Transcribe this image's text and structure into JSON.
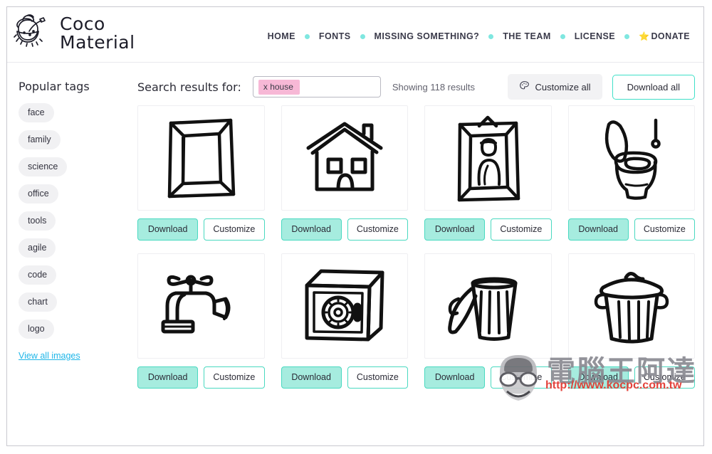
{
  "site": {
    "logo_line1": "Coco",
    "logo_line2": "Material",
    "logo_icon": "coconut-drink-icon"
  },
  "nav": {
    "items": [
      {
        "label": "HOME"
      },
      {
        "label": "FONTS"
      },
      {
        "label": "MISSING SOMETHING?"
      },
      {
        "label": "THE TEAM"
      },
      {
        "label": "LICENSE"
      },
      {
        "label": "DONATE",
        "star": "⭐"
      }
    ],
    "separator_icon": "dot-separator-icon",
    "separator_color": "#7fe7e0"
  },
  "sidebar": {
    "title": "Popular tags",
    "tags": [
      {
        "label": "face"
      },
      {
        "label": "family"
      },
      {
        "label": "science"
      },
      {
        "label": "office"
      },
      {
        "label": "tools"
      },
      {
        "label": "agile"
      },
      {
        "label": "code"
      },
      {
        "label": "chart"
      },
      {
        "label": "logo"
      }
    ],
    "view_all_label": "View all images",
    "link_color": "#1fb6e8"
  },
  "search": {
    "label": "Search results for:",
    "chip": "x house",
    "chip_color": "#f7b8d6",
    "results_text": "Showing 118 results",
    "customize_all_label": "Customize all",
    "customize_all_icon": "palette-icon",
    "download_all_label": "Download all",
    "accent_color": "#3fe0c8"
  },
  "card_buttons": {
    "download_label": "Download",
    "customize_label": "Customize",
    "download_bg": "#a6ecdf",
    "border_color": "#49d9c0"
  },
  "results": [
    {
      "name": "picture-frame",
      "icon": "picture-frame-icon"
    },
    {
      "name": "house",
      "icon": "house-icon"
    },
    {
      "name": "framed-portrait",
      "icon": "framed-portrait-icon"
    },
    {
      "name": "toilet",
      "icon": "toilet-icon"
    },
    {
      "name": "faucet",
      "icon": "faucet-icon"
    },
    {
      "name": "safe-box",
      "icon": "safe-box-icon"
    },
    {
      "name": "trash-bin-open",
      "icon": "trash-bin-open-icon"
    },
    {
      "name": "trash-bin-closed",
      "icon": "trash-bin-closed-icon"
    }
  ],
  "watermark": {
    "text": "電腦王阿達",
    "url": "http://www.kocpc.com.tw",
    "url_color": "#e2342c",
    "face_icon": "cartoon-face-icon"
  }
}
